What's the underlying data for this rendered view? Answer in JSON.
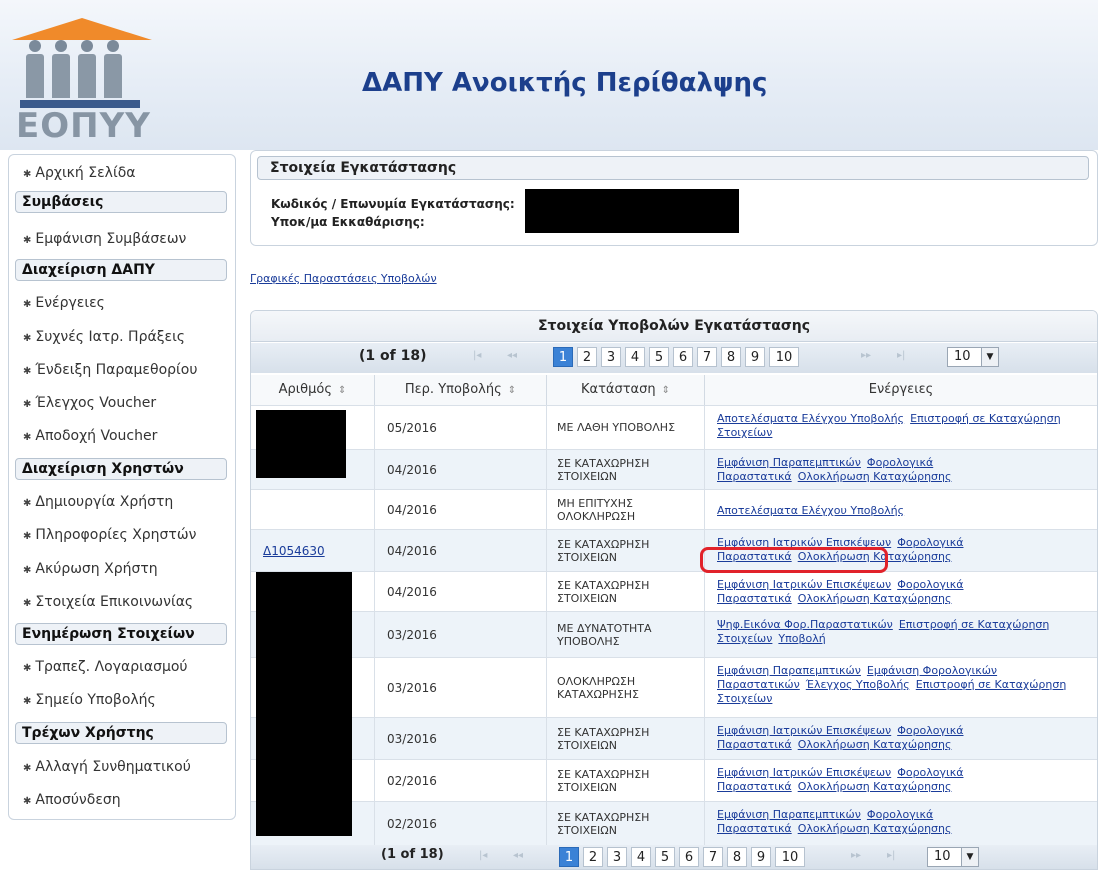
{
  "header": {
    "logo_text": "ΕΟΠΥΥ",
    "title": "ΔΑΠΥ Ανοικτής Περίθαλψης"
  },
  "sidebar": {
    "home": "Αρχική Σελίδα",
    "contracts_head": "Συμβάσεις",
    "contracts_view": "Εμφάνιση Συμβάσεων",
    "dapy_head": "Διαχείριση ΔΑΠΥ",
    "actions": "Ενέργειες",
    "frequent": "Συχνές Ιατρ. Πράξεις",
    "parametrics": "Ένδειξη Παραμεθορίου",
    "voucher_check": "Έλεγχος Voucher",
    "voucher_accept": "Αποδοχή Voucher",
    "users_head": "Διαχείριση Χρηστών",
    "user_create": "Δημιουργία Χρήστη",
    "user_info": "Πληροφορίες Χρηστών",
    "user_cancel": "Ακύρωση Χρήστη",
    "contact": "Στοιχεία Επικοινωνίας",
    "update_head": "Ενημέρωση Στοιχείων",
    "bank": "Τραπεζ. Λογαριασμού",
    "submit_point": "Σημείο Υποβολής",
    "current_head": "Τρέχων Χρήστης",
    "change_pw": "Αλλαγή Συνθηματικού",
    "logout": "Αποσύνδεση"
  },
  "install": {
    "title": "Στοιχεία Εγκατάστασης",
    "code_label": "Κωδικός / Επωνυμία Εγκατάστασης:",
    "sub_label": "Υποκ/μα Εκκαθάρισης:"
  },
  "charts_link": "Γραφικές Παραστάσεις Υποβολών",
  "table": {
    "caption": "Στοιχεία Υποβολών Εγκατάστασης",
    "pager": {
      "info": "(1 of 18)",
      "first": "|◂",
      "prev": "◂◂",
      "next": "▸▸",
      "last": "▸|",
      "pages": [
        "1",
        "2",
        "3",
        "4",
        "5",
        "6",
        "7",
        "8",
        "9",
        "10"
      ],
      "page_size": "10"
    },
    "columns": [
      "Αριθμός",
      "Περ. Υποβολής",
      "Κατάσταση",
      "Ενέργειες"
    ],
    "sort_glyph": "⇕",
    "rows": [
      {
        "id": "",
        "period": "05/2016",
        "status": "ΜΕ ΛΑΘΗ ΥΠΟΒΟΛΗΣ",
        "actions": [
          "Αποτελέσματα Ελέγχου Υποβολής",
          "Επιστροφή σε Καταχώρηση Στοιχείων"
        ]
      },
      {
        "id": "",
        "period": "04/2016",
        "status": "ΣΕ ΚΑΤΑΧΩΡΗΣΗ ΣΤΟΙΧΕΙΩΝ",
        "actions": [
          "Εμφάνιση Παραπεμπτικών",
          "Φορολογικά Παραστατικά",
          "Ολοκλήρωση Καταχώρησης"
        ]
      },
      {
        "id": "",
        "period": "04/2016",
        "status": "ΜΗ ΕΠΙΤΥΧΗΣ ΟΛΟΚΛΗΡΩΣΗ",
        "actions": [
          "Αποτελέσματα Ελέγχου Υποβολής"
        ]
      },
      {
        "id": "Δ1054630",
        "period": "04/2016",
        "status": "ΣΕ ΚΑΤΑΧΩΡΗΣΗ ΣΤΟΙΧΕΙΩΝ",
        "actions": [
          "Εμφάνιση Ιατρικών Επισκέψεων",
          "Φορολογικά Παραστατικά",
          "Ολοκλήρωση Καταχώρησης"
        ]
      },
      {
        "id": "",
        "period": "04/2016",
        "status": "ΣΕ ΚΑΤΑΧΩΡΗΣΗ ΣΤΟΙΧΕΙΩΝ",
        "actions": [
          "Εμφάνιση Ιατρικών Επισκέψεων",
          "Φορολογικά Παραστατικά",
          "Ολοκλήρωση Καταχώρησης"
        ]
      },
      {
        "id": "",
        "period": "03/2016",
        "status": "ΜΕ ΔΥΝΑΤΟΤΗΤΑ ΥΠΟΒΟΛΗΣ",
        "actions": [
          "Ψηφ.Εικόνα Φορ.Παραστατικών",
          "Επιστροφή σε Καταχώρηση Στοιχείων",
          "Υποβολή"
        ]
      },
      {
        "id": "",
        "period": "03/2016",
        "status": "ΟΛΟΚΛΗΡΩΣΗ ΚΑΤΑΧΩΡΗΣΗΣ",
        "actions": [
          "Εμφάνιση Παραπεμπτικών",
          "Εμφάνιση Φορολογικών Παραστατικών",
          "Έλεγχος Υποβολής",
          "Επιστροφή σε Καταχώρηση Στοιχείων"
        ]
      },
      {
        "id": "",
        "period": "03/2016",
        "status": "ΣΕ ΚΑΤΑΧΩΡΗΣΗ ΣΤΟΙΧΕΙΩΝ",
        "actions": [
          "Εμφάνιση Ιατρικών Επισκέψεων",
          "Φορολογικά Παραστατικά",
          "Ολοκλήρωση Καταχώρησης"
        ]
      },
      {
        "id": "",
        "period": "02/2016",
        "status": "ΣΕ ΚΑΤΑΧΩΡΗΣΗ ΣΤΟΙΧΕΙΩΝ",
        "actions": [
          "Εμφάνιση Ιατρικών Επισκέψεων",
          "Φορολογικά Παραστατικά",
          "Ολοκλήρωση Καταχώρησης"
        ]
      },
      {
        "id": "",
        "period": "02/2016",
        "status": "ΣΕ ΚΑΤΑΧΩΡΗΣΗ ΣΤΟΙΧΕΙΩΝ",
        "actions": [
          "Εμφάνιση Παραπεμπτικών",
          "Φορολογικά Παραστατικά",
          "Ολοκλήρωση Καταχώρησης"
        ]
      }
    ]
  },
  "colors": {
    "title": "#1c3f8c",
    "link": "#1a3c9a",
    "active_page": "#3b82d6",
    "highlight": "#e1222a",
    "logo_orange": "#f08a2a"
  }
}
